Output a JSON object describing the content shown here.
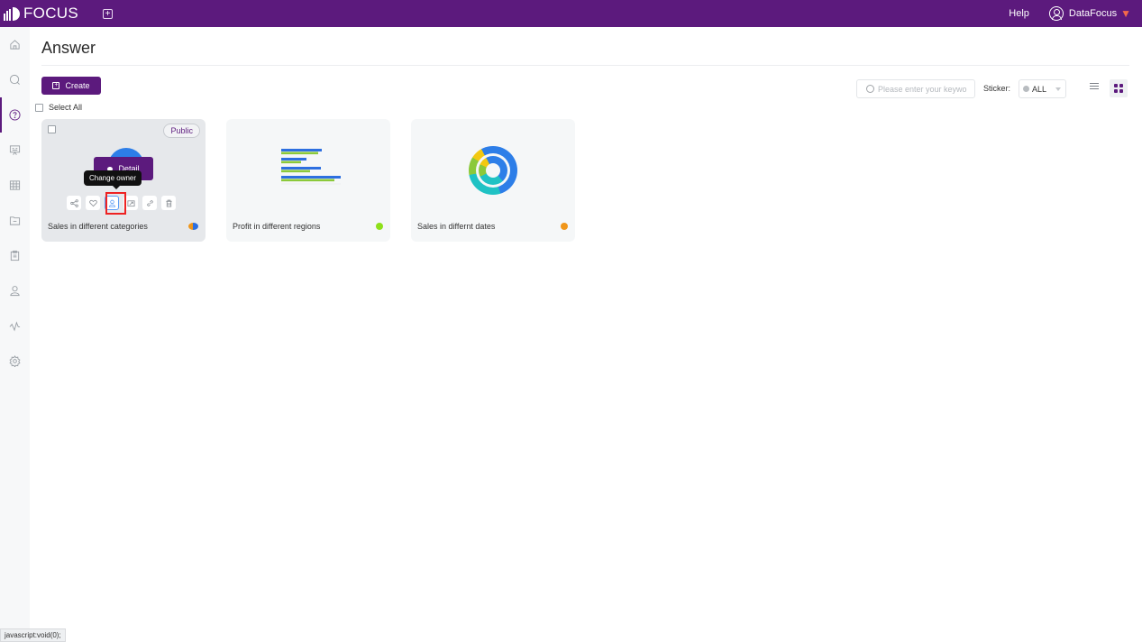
{
  "header": {
    "app_name": "FOCUS",
    "new_tab_icon": "plus-square-icon",
    "help_label": "Help",
    "user_name": "DataFocus",
    "user_icon": "user-circle-icon",
    "badge_icon": "gem-icon",
    "brand_color": "#5c1a7d"
  },
  "sidebar": {
    "items": [
      {
        "name": "home",
        "icon": "home-icon",
        "active": false
      },
      {
        "name": "search",
        "icon": "search-icon",
        "active": false
      },
      {
        "name": "answer",
        "icon": "question-circle-icon",
        "active": true
      },
      {
        "name": "presentation",
        "icon": "presentation-icon",
        "active": false
      },
      {
        "name": "table",
        "icon": "table-icon",
        "active": false
      },
      {
        "name": "folder",
        "icon": "folder-icon",
        "active": false
      },
      {
        "name": "clipboard",
        "icon": "clipboard-icon",
        "active": false
      },
      {
        "name": "user",
        "icon": "user-icon",
        "active": false
      },
      {
        "name": "monitor",
        "icon": "pulse-icon",
        "active": false
      },
      {
        "name": "settings",
        "icon": "gear-icon",
        "active": false
      }
    ]
  },
  "page": {
    "title": "Answer",
    "create_label": "Create",
    "select_all_label": "Select All",
    "search_placeholder": "Please enter your keywo",
    "sticker_label": "Sticker:",
    "sticker_value": "ALL"
  },
  "cards": [
    {
      "title": "Sales in different categories",
      "badge": "Public",
      "detail_label": "Detail",
      "tooltip": "Change owner",
      "thumbnail": "pie-chart",
      "sticker_colors": [
        "#f0961a",
        "#2d6fe0"
      ],
      "actions": [
        "share-icon",
        "heart-icon",
        "change-owner-icon",
        "export-icon",
        "link-icon",
        "trash-icon"
      ]
    },
    {
      "title": "Profit in different regions",
      "thumbnail": "horizontal-bar-chart",
      "sticker_colors": [
        "#8ee01a"
      ]
    },
    {
      "title": "Sales in differnt dates",
      "thumbnail": "sunburst-chart",
      "sticker_colors": [
        "#f0961a"
      ]
    }
  ],
  "status_bar": {
    "text": "javascript:void(0);"
  }
}
